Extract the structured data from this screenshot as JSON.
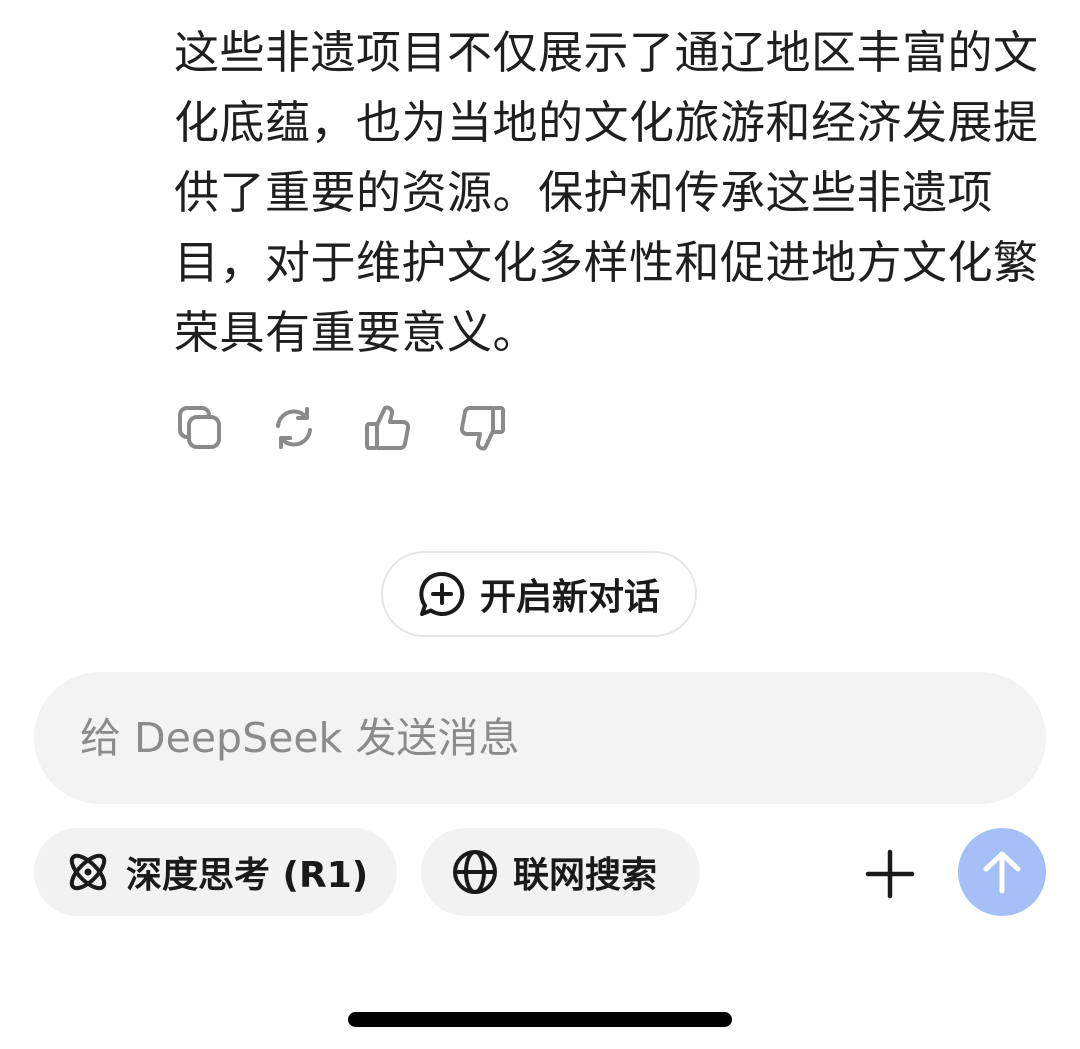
{
  "message": {
    "text": "这些非遗项目不仅展示了通辽地区丰富的文化底蕴，也为当地的文化旅游和经济发展提供了重要的资源。保护和传承这些非遗项目，对于维护文化多样性和促进地方文化繁荣具有重要意义。"
  },
  "actions": {
    "copy_icon": "copy-icon",
    "regenerate_icon": "refresh-icon",
    "like_icon": "thumbs-up-icon",
    "dislike_icon": "thumbs-down-icon"
  },
  "new_chat": {
    "label": "开启新对话",
    "icon": "chat-plus-icon"
  },
  "composer": {
    "placeholder": "给 DeepSeek 发送消息",
    "value": ""
  },
  "toolbar": {
    "deep_think_label": "深度思考 (R1)",
    "deep_think_icon": "atom-icon",
    "web_search_label": "联网搜索",
    "web_search_icon": "globe-icon",
    "attach_icon": "plus-icon",
    "send_icon": "arrow-up-icon"
  },
  "colors": {
    "send_button": "#a5bff7",
    "composer_bg": "#f3f3f3",
    "chip_bg": "#f2f2f2",
    "text": "#1a1a1a",
    "placeholder": "#8b8b8b"
  }
}
